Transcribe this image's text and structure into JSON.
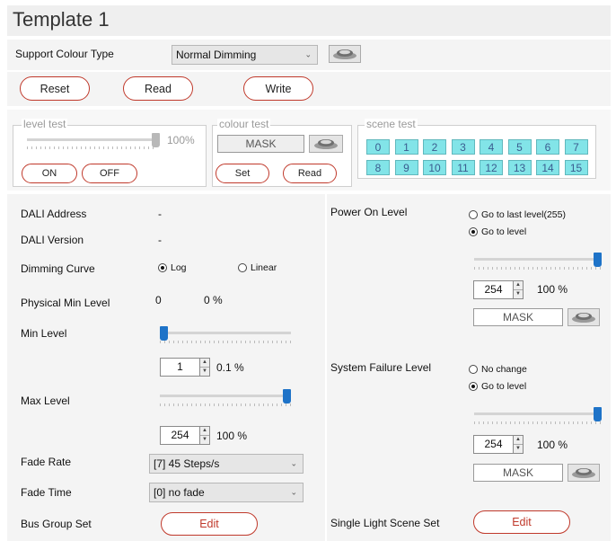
{
  "title": "Template 1",
  "support": {
    "label": "Support Colour Type",
    "selected": "Normal Dimming"
  },
  "actions": {
    "reset": "Reset",
    "read": "Read",
    "write": "Write"
  },
  "level_test": {
    "legend": "level test",
    "percent": "100%",
    "level_fraction": 1.0,
    "on": "ON",
    "off": "OFF"
  },
  "colour_test": {
    "legend": "colour test",
    "mask": "MASK",
    "set": "Set",
    "read": "Read"
  },
  "scene_test": {
    "legend": "scene test",
    "scenes": [
      "0",
      "1",
      "2",
      "3",
      "4",
      "5",
      "6",
      "7",
      "8",
      "9",
      "10",
      "11",
      "12",
      "13",
      "14",
      "15"
    ]
  },
  "left": {
    "dali_address": {
      "label": "DALI Address",
      "value": "-"
    },
    "dali_version": {
      "label": "DALI Version",
      "value": "-"
    },
    "dimming_curve": {
      "label": "Dimming Curve",
      "log": "Log",
      "linear": "Linear",
      "selected": "Log"
    },
    "physical_min": {
      "label": "Physical Min Level",
      "value": "0",
      "percent": "0 %"
    },
    "min_level": {
      "label": "Min Level",
      "value": "1",
      "percent": "0.1 %",
      "slider_fraction": 0.0
    },
    "max_level": {
      "label": "Max Level",
      "value": "254",
      "percent": "100 %",
      "slider_fraction": 1.0
    },
    "fade_rate": {
      "label": "Fade Rate",
      "selected": "[7] 45 Steps/s"
    },
    "fade_time": {
      "label": "Fade Time",
      "selected": "[0] no fade"
    },
    "bus_group": {
      "label": "Bus Group Set",
      "edit": "Edit"
    }
  },
  "right": {
    "power_on": {
      "label": "Power On Level",
      "opt1": "Go to last level(255)",
      "opt2": "Go to level",
      "selected": "Go to level",
      "slider_fraction": 1.0,
      "value": "254",
      "percent": "100 %",
      "mask": "MASK"
    },
    "system_failure": {
      "label": "System Failure Level",
      "opt1": "No change",
      "opt2": "Go to level",
      "selected": "Go to level",
      "slider_fraction": 1.0,
      "value": "254",
      "percent": "100 %",
      "mask": "MASK"
    },
    "single_scene": {
      "label": "Single Light Scene Set",
      "edit": "Edit"
    }
  },
  "icons": {
    "lamp": "lamp-icon",
    "chevron": "chevron-down-icon",
    "spin_up": "spin-up-icon",
    "spin_down": "spin-down-icon"
  },
  "colors": {
    "accent_border": "#c0392b",
    "scene_cell": "#82e4e8",
    "slider_thumb": "#1e73c8",
    "panel_bg": "#f4f4f4"
  }
}
